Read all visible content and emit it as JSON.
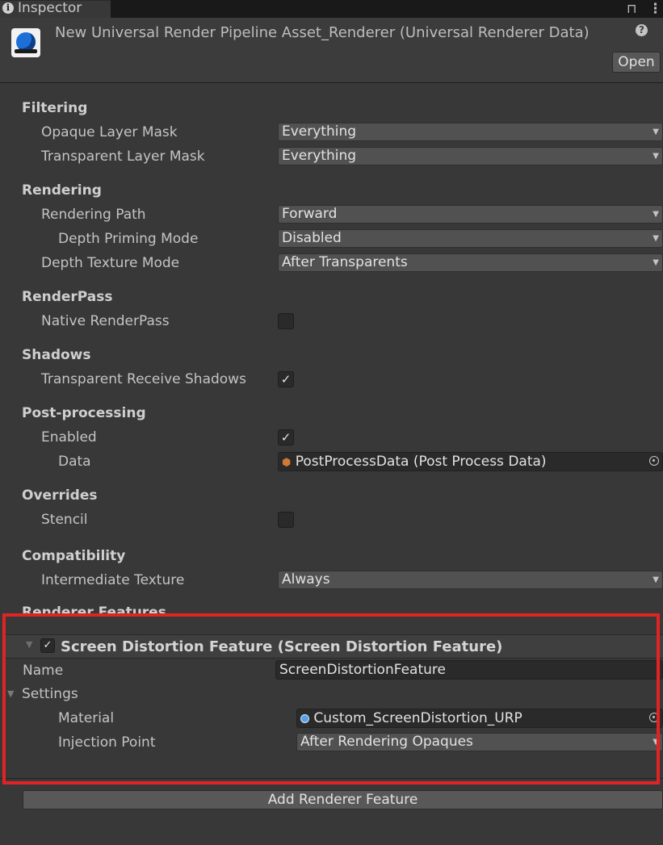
{
  "tab": {
    "title": "Inspector"
  },
  "header": {
    "title": "New Universal Render Pipeline Asset_Renderer (Universal Renderer Data)",
    "open_label": "Open"
  },
  "sections": {
    "filtering": "Filtering",
    "rendering": "Rendering",
    "renderpass": "RenderPass",
    "shadows": "Shadows",
    "postprocessing": "Post-processing",
    "overrides": "Overrides",
    "compatibility": "Compatibility",
    "renderer_features": "Renderer Features"
  },
  "fields": {
    "opaque_layer_mask": {
      "label": "Opaque Layer Mask",
      "value": "Everything"
    },
    "transparent_layer_mask": {
      "label": "Transparent Layer Mask",
      "value": "Everything"
    },
    "rendering_path": {
      "label": "Rendering Path",
      "value": "Forward"
    },
    "depth_priming_mode": {
      "label": "Depth Priming Mode",
      "value": "Disabled"
    },
    "depth_texture_mode": {
      "label": "Depth Texture Mode",
      "value": "After Transparents"
    },
    "native_renderpass": {
      "label": "Native RenderPass",
      "checked": false
    },
    "transparent_receive_shadows": {
      "label": "Transparent Receive Shadows",
      "checked": true
    },
    "pp_enabled": {
      "label": "Enabled",
      "checked": true
    },
    "pp_data": {
      "label": "Data",
      "value": "PostProcessData (Post Process Data)"
    },
    "stencil": {
      "label": "Stencil",
      "checked": false
    },
    "intermediate_texture": {
      "label": "Intermediate Texture",
      "value": "Always"
    }
  },
  "feature": {
    "title": "Screen Distortion Feature (Screen Distortion Feature)",
    "enabled": true,
    "name_label": "Name",
    "name_value": "ScreenDistortionFeature",
    "settings_label": "Settings",
    "material_label": "Material",
    "material_value": "Custom_ScreenDistortion_URP",
    "injection_label": "Injection Point",
    "injection_value": "After Rendering Opaques"
  },
  "add_feature_label": "Add Renderer Feature",
  "icons": {
    "info": "info-icon",
    "lock": "lock-icon",
    "menu": "kebab-menu-icon",
    "asset": "render-pipeline-asset-icon",
    "help": "help-icon",
    "dropdown": "dropdown-arrow-icon",
    "object_picker": "object-picker-icon",
    "foldout": "foldout-arrow-icon",
    "check": "checkmark-icon"
  },
  "colors": {
    "background": "#383838",
    "highlight_border": "#e02424",
    "field_bg": "#2a2a2a",
    "dropdown_bg": "#515151"
  }
}
